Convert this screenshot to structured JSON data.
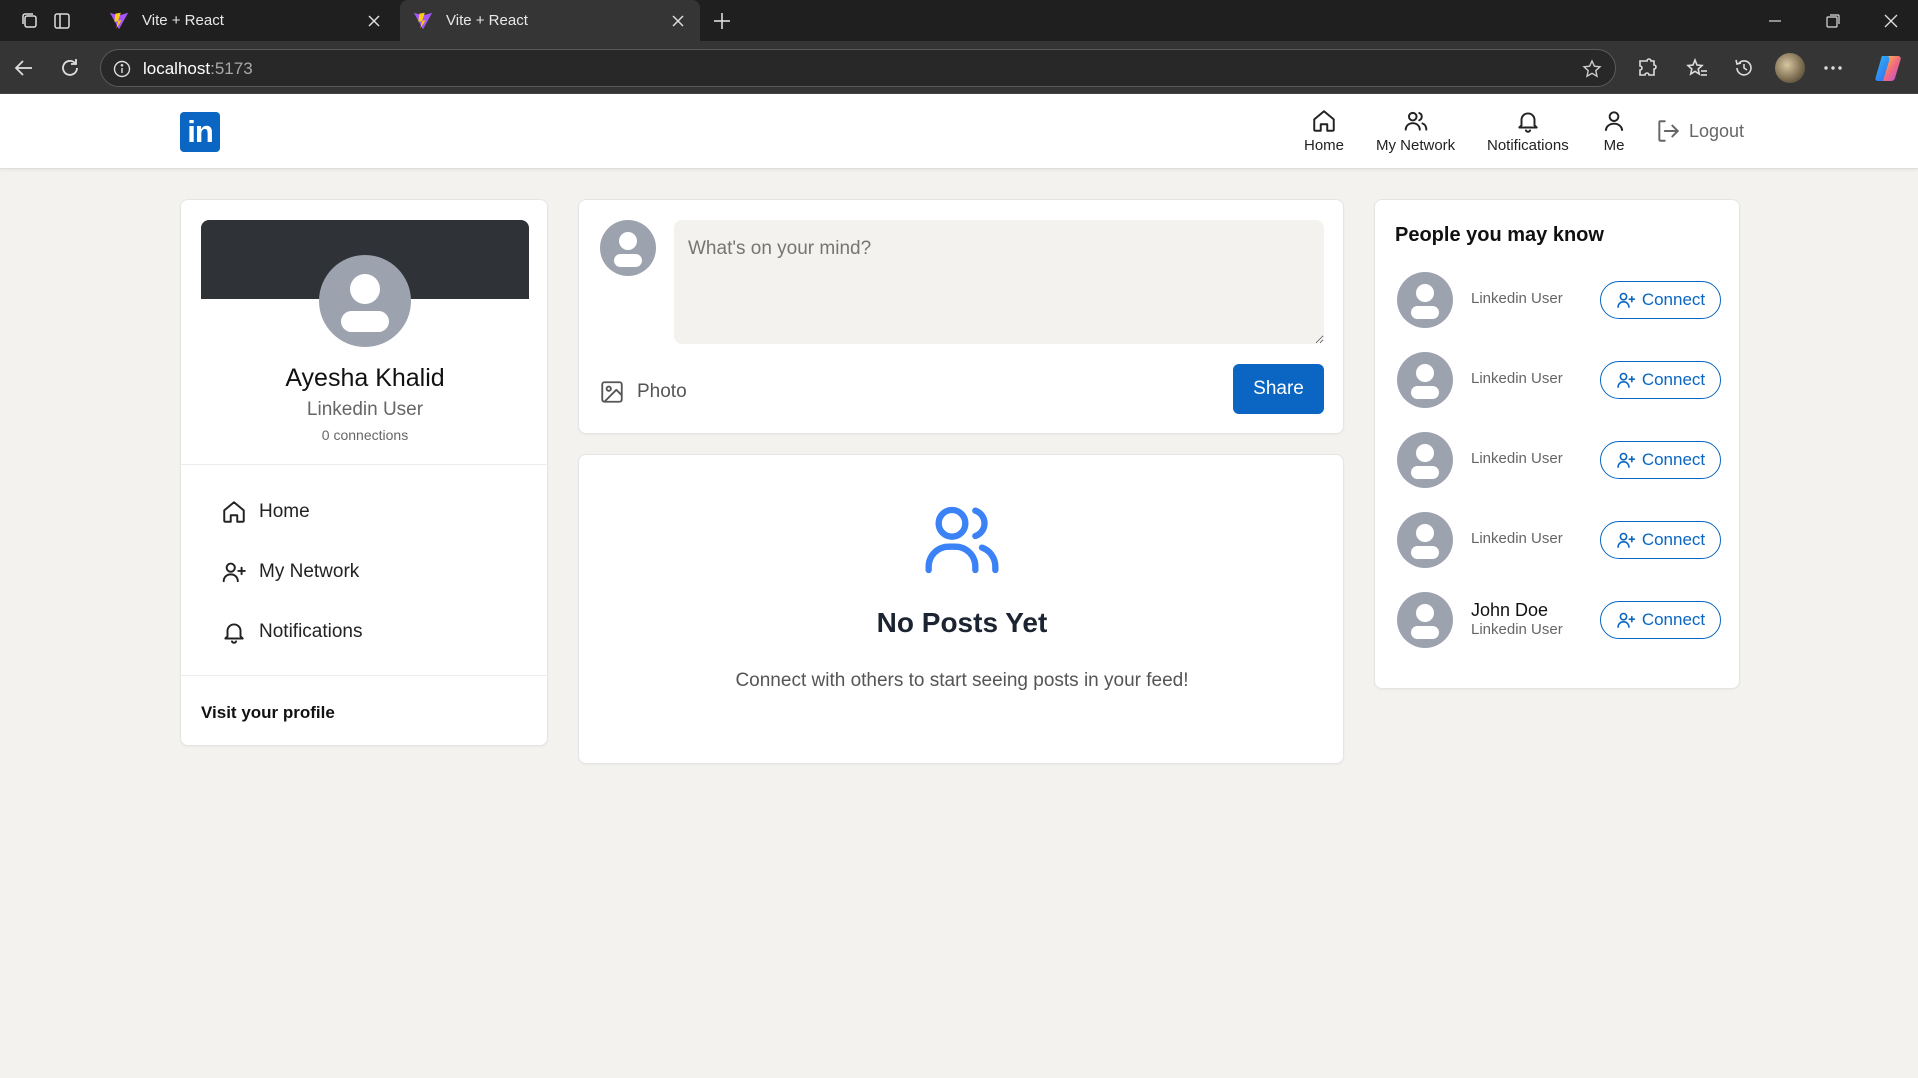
{
  "browser": {
    "tabs": [
      {
        "title": "Vite + React"
      },
      {
        "title": "Vite + React"
      }
    ],
    "url_host": "localhost",
    "url_port": ":5173"
  },
  "nav": {
    "logo": "in",
    "items": [
      {
        "label": "Home"
      },
      {
        "label": "My Network"
      },
      {
        "label": "Notifications"
      },
      {
        "label": "Me"
      }
    ],
    "logout": "Logout"
  },
  "profile": {
    "name": "Ayesha Khalid",
    "headline": "Linkedin User",
    "connections": "0 connections",
    "links": [
      {
        "label": "Home"
      },
      {
        "label": "My Network"
      },
      {
        "label": "Notifications"
      }
    ],
    "visit": "Visit your profile"
  },
  "composer": {
    "placeholder": "What's on your mind?",
    "photo_label": "Photo",
    "share_label": "Share"
  },
  "feed": {
    "empty_title": "No Posts Yet",
    "empty_sub": "Connect with others to start seeing posts in your feed!"
  },
  "suggestions": {
    "title": "People you may know",
    "connect_label": "Connect",
    "people": [
      {
        "name": "",
        "headline": "Linkedin User"
      },
      {
        "name": "",
        "headline": "Linkedin User"
      },
      {
        "name": "",
        "headline": "Linkedin User"
      },
      {
        "name": "",
        "headline": "Linkedin User"
      },
      {
        "name": "John Doe",
        "headline": "Linkedin User"
      }
    ]
  },
  "colors": {
    "brand": "#0a66c2",
    "page_bg": "#f3f2ef",
    "cover": "#2f3236",
    "empty_icon": "#3b82f6"
  }
}
